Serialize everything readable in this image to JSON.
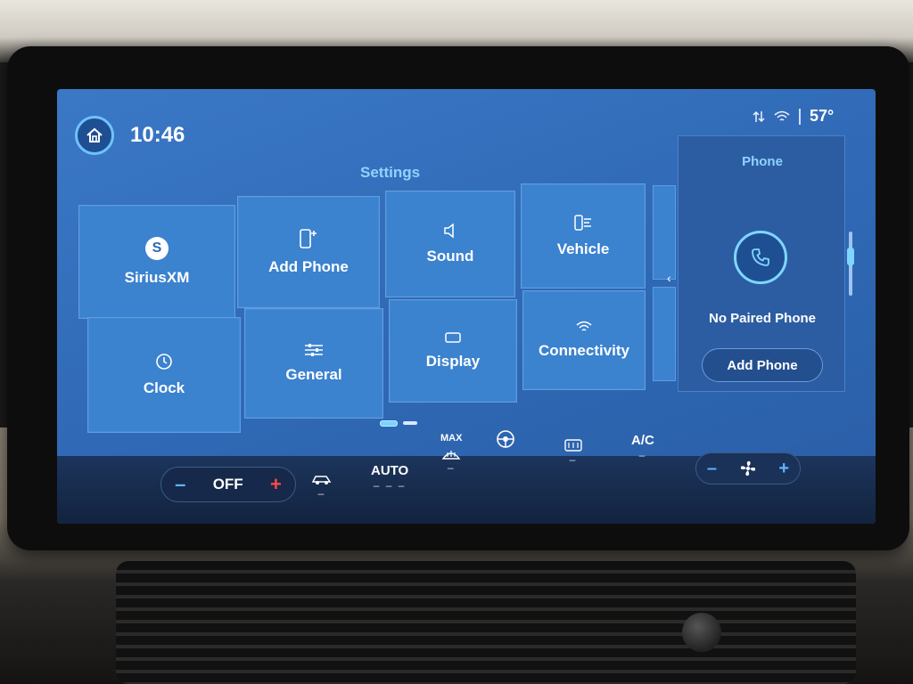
{
  "status": {
    "time": "10:46",
    "temperature": "57°",
    "icons": [
      "data-transfer-icon",
      "wifi-icon"
    ]
  },
  "settings": {
    "title": "Settings",
    "tiles": [
      {
        "label": "SiriusXM",
        "icon": "siriusxm-icon"
      },
      {
        "label": "Add Phone",
        "icon": "add-phone-icon"
      },
      {
        "label": "Sound",
        "icon": "speaker-icon"
      },
      {
        "label": "Vehicle",
        "icon": "vehicle-icon"
      },
      {
        "label": "Clock",
        "icon": "clock-icon"
      },
      {
        "label": "General",
        "icon": "sliders-icon"
      },
      {
        "label": "Display",
        "icon": "display-icon"
      },
      {
        "label": "Connectivity",
        "icon": "wifi-icon"
      }
    ],
    "page": {
      "current": 1,
      "total": 2
    }
  },
  "phone_panel": {
    "title": "Phone",
    "status": "No Paired Phone",
    "add_button": "Add Phone"
  },
  "climate": {
    "driver_temp": "OFF",
    "auto_label": "AUTO",
    "max_label": "MAX",
    "ac_label": "A/C",
    "auto_indicator": "– – –",
    "colors": {
      "minus": "#5fb4ff",
      "plus": "#ff4848"
    }
  }
}
